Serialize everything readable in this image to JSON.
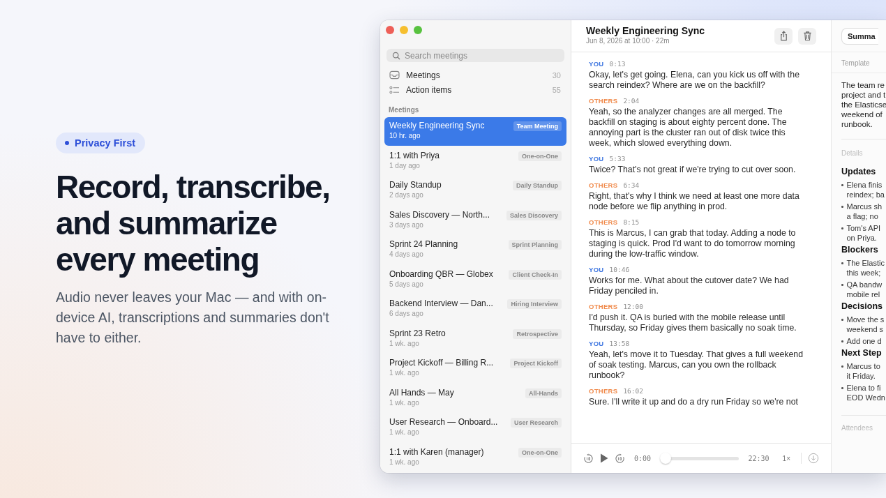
{
  "hero": {
    "badge": "Privacy First",
    "headline": "Record, transcribe, and summarize every meeting",
    "subtitle": "Audio never leaves your Mac — and with on-device AI, transcriptions and summaries don't have to either."
  },
  "sidebar": {
    "search": {
      "placeholder": "Search meetings"
    },
    "nav": [
      {
        "kind": "meetings",
        "label": "Meetings",
        "count": "30"
      },
      {
        "kind": "actions",
        "label": "Action items",
        "count": "55"
      }
    ],
    "section": "Meetings",
    "meetings": [
      {
        "title": "Weekly Engineering Sync",
        "time": "10 hr. ago",
        "tag": "Team Meeting",
        "selected": true
      },
      {
        "title": "1:1 with Priya",
        "time": "1 day ago",
        "tag": "One-on-One",
        "selected": false
      },
      {
        "title": "Daily Standup",
        "time": "2 days ago",
        "tag": "Daily Standup",
        "selected": false
      },
      {
        "title": "Sales Discovery — North...",
        "time": "3 days ago",
        "tag": "Sales Discovery",
        "selected": false
      },
      {
        "title": "Sprint 24 Planning",
        "time": "4 days ago",
        "tag": "Sprint Planning",
        "selected": false
      },
      {
        "title": "Onboarding QBR — Globex",
        "time": "5 days ago",
        "tag": "Client Check-In",
        "selected": false
      },
      {
        "title": "Backend Interview — Dan...",
        "time": "6 days ago",
        "tag": "Hiring Interview",
        "selected": false
      },
      {
        "title": "Sprint 23 Retro",
        "time": "1 wk. ago",
        "tag": "Retrospective",
        "selected": false
      },
      {
        "title": "Project Kickoff — Billing R...",
        "time": "1 wk. ago",
        "tag": "Project Kickoff",
        "selected": false
      },
      {
        "title": "All Hands — May",
        "time": "1 wk. ago",
        "tag": "All-Hands",
        "selected": false
      },
      {
        "title": "User Research — Onboard...",
        "time": "1 wk. ago",
        "tag": "User Research",
        "selected": false
      },
      {
        "title": "1:1 with Karen (manager)",
        "time": "1 wk. ago",
        "tag": "One-on-One",
        "selected": false
      }
    ]
  },
  "meeting": {
    "title": "Weekly Engineering Sync",
    "meta": "Jun 8, 2026 at 10:00 · 22m"
  },
  "transcript": [
    {
      "speaker": "YOU",
      "kind": "you",
      "time": "0:13",
      "text": "Okay, let's get going. Elena, can you kick us off with the search reindex? Where are we on the backfill?"
    },
    {
      "speaker": "OTHERS",
      "kind": "others",
      "time": "2:04",
      "text": "Yeah, so the analyzer changes are all merged. The backfill on staging is about eighty percent done. The annoying part is the cluster ran out of disk twice this week, which slowed everything down."
    },
    {
      "speaker": "YOU",
      "kind": "you",
      "time": "5:33",
      "text": "Twice? That's not great if we're trying to cut over soon."
    },
    {
      "speaker": "OTHERS",
      "kind": "others",
      "time": "6:34",
      "text": "Right, that's why I think we need at least one more data node before we flip anything in prod."
    },
    {
      "speaker": "OTHERS",
      "kind": "others",
      "time": "8:15",
      "text": "This is Marcus, I can grab that today. Adding a node to staging is quick. Prod I'd want to do tomorrow morning during the low-traffic window."
    },
    {
      "speaker": "YOU",
      "kind": "you",
      "time": "10:46",
      "text": "Works for me. What about the cutover date? We had Friday penciled in."
    },
    {
      "speaker": "OTHERS",
      "kind": "others",
      "time": "12:00",
      "text": "I'd push it. QA is buried with the mobile release until Thursday, so Friday gives them basically no soak time."
    },
    {
      "speaker": "YOU",
      "kind": "you",
      "time": "13:58",
      "text": "Yeah, let's move it to Tuesday. That gives a full weekend of soak testing. Marcus, can you own the rollback runbook?"
    },
    {
      "speaker": "OTHERS",
      "kind": "others",
      "time": "16:02",
      "text": "Sure. I'll write it up and do a dry run Friday so we're not"
    }
  ],
  "player": {
    "elapsed": "0:00",
    "level": 0,
    "duration": "22:30",
    "speed": "1×"
  },
  "summary": {
    "tab": "Summa",
    "template_label": "Template",
    "overview": [
      "The team re",
      "project and t",
      "the Elasticse",
      "weekend of",
      "runbook."
    ],
    "details_label": "Details",
    "sections": [
      {
        "heading": "Updates",
        "bullets": [
          [
            "Elena finis",
            "reindex; ba"
          ],
          [
            "Marcus sh",
            "a flag; no"
          ],
          [
            "Tom's API",
            "on Priya."
          ]
        ]
      },
      {
        "heading": "Blockers",
        "bullets": [
          [
            "The Elastic",
            "this week;"
          ],
          [
            "QA bandw",
            "mobile rel"
          ]
        ]
      },
      {
        "heading": "Decisions",
        "bullets": [
          [
            "Move the s",
            "weekend s"
          ],
          [
            "Add one d"
          ]
        ]
      },
      {
        "heading": "Next Step",
        "bullets": [
          [
            "Marcus to",
            "it Friday."
          ],
          [
            "Elena to fi",
            "EOD Wedn"
          ]
        ]
      }
    ],
    "attendees_label": "Attendees"
  }
}
